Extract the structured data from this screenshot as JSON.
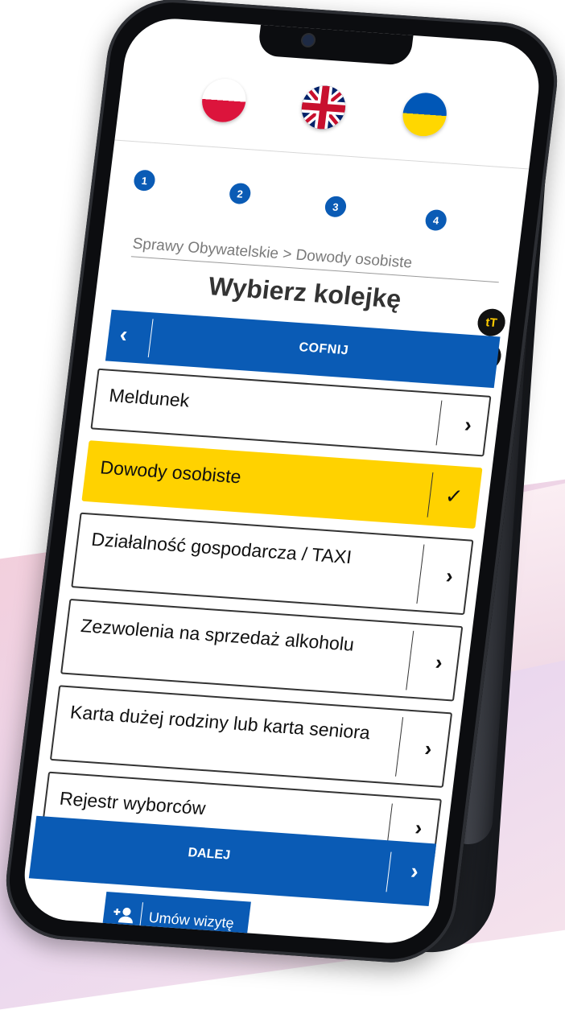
{
  "languages": [
    {
      "name": "polish-flag",
      "label": "PL"
    },
    {
      "name": "uk-flag",
      "label": "EN"
    },
    {
      "name": "ukraine-flag",
      "label": "UA"
    }
  ],
  "steps": [
    "1",
    "2",
    "3",
    "4"
  ],
  "breadcrumb": "Sprawy Obywatelskie > Dowody osobiste",
  "title": "Wybierz kolejkę",
  "tools": {
    "text_size_icon": "tT",
    "contrast_icon": "contrast-icon"
  },
  "back_button": {
    "label": "COFNIJ",
    "icon": "chevron-left-icon"
  },
  "queues": [
    {
      "label": "Meldunek",
      "selected": false
    },
    {
      "label": "Dowody osobiste",
      "selected": true
    },
    {
      "label": "Działalność gospodarcza / TAXI",
      "selected": false
    },
    {
      "label": "Zezwolenia na sprzedaż alkoholu",
      "selected": false
    },
    {
      "label": "Karta dużej rodziny lub karta seniora",
      "selected": false
    },
    {
      "label": "Rejestr wyborców",
      "selected": false
    }
  ],
  "next_button": {
    "label": "DALEJ",
    "icon": "chevron-right-icon"
  },
  "appointment_button": {
    "label": "Umów wizytę",
    "icon": "add-person-icon"
  },
  "colors": {
    "primary": "#0a5bb5",
    "selected": "#ffd200",
    "tool_bg": "#111111",
    "tool_fg": "#ffcc00"
  }
}
